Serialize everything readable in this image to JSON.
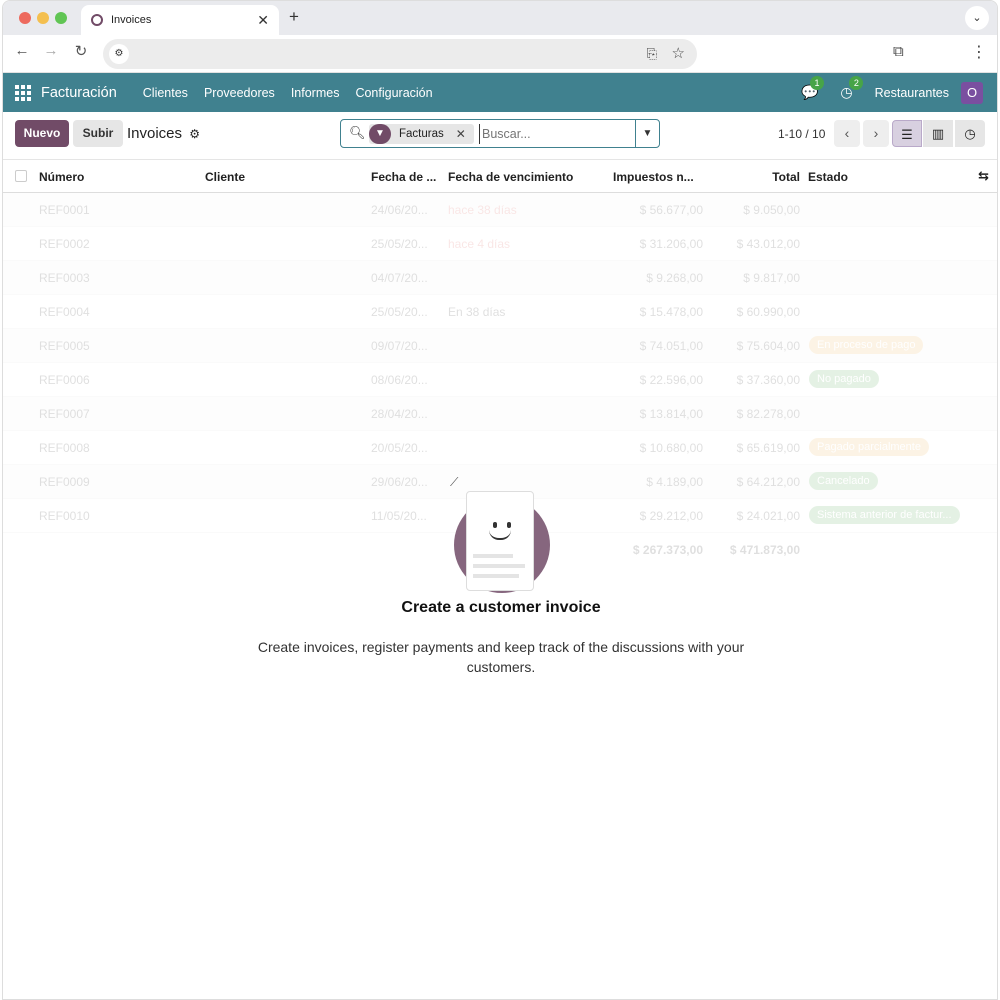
{
  "browser": {
    "tab_title": "Invoices",
    "new_tab": "+",
    "url": ""
  },
  "navbar": {
    "app_name": "Facturación",
    "menus": [
      "Clientes",
      "Proveedores",
      "Informes",
      "Configuración"
    ],
    "messages_count": "1",
    "activities_count": "2",
    "company": "Restaurantes",
    "avatar_letter": "O"
  },
  "control": {
    "new_label": "Nuevo",
    "upload_label": "Subir",
    "view_title": "Invoices",
    "facet_label": "Facturas",
    "search_placeholder": "Buscar...",
    "pager": "1-10 / 10"
  },
  "table": {
    "headers": {
      "numero": "Número",
      "cliente": "Cliente",
      "fecha": "Fecha de ...",
      "vencimiento": "Fecha de vencimiento",
      "impuestos": "Impuestos n...",
      "total": "Total",
      "estado": "Estado"
    },
    "rows": [
      {
        "num": "REF0001",
        "date": "24/06/20...",
        "due": "hace 38 días",
        "tax": "$ 56.677,00",
        "total": "$ 9.050,00",
        "state": ""
      },
      {
        "num": "REF0002",
        "date": "25/05/20...",
        "due": "hace 4 días",
        "tax": "$ 31.206,00",
        "total": "$ 43.012,00",
        "state": ""
      },
      {
        "num": "REF0003",
        "date": "04/07/20...",
        "due": "",
        "tax": "$ 9.268,00",
        "total": "$ 9.817,00",
        "state": ""
      },
      {
        "num": "REF0004",
        "date": "25/05/20...",
        "due": "En 38 días",
        "tax": "$ 15.478,00",
        "total": "$ 60.990,00",
        "state": ""
      },
      {
        "num": "REF0005",
        "date": "09/07/20...",
        "due": "",
        "tax": "$ 74.051,00",
        "total": "$ 75.604,00",
        "state": "En proceso de pago"
      },
      {
        "num": "REF0006",
        "date": "08/06/20...",
        "due": "",
        "tax": "$ 22.596,00",
        "total": "$ 37.360,00",
        "state": "No pagado"
      },
      {
        "num": "REF0007",
        "date": "28/04/20...",
        "due": "",
        "tax": "$ 13.814,00",
        "total": "$ 82.278,00",
        "state": ""
      },
      {
        "num": "REF0008",
        "date": "20/05/20...",
        "due": "",
        "tax": "$ 10.680,00",
        "total": "$ 65.619,00",
        "state": "Pagado parcialmente"
      },
      {
        "num": "REF0009",
        "date": "29/06/20...",
        "due": "",
        "tax": "$ 4.189,00",
        "total": "$ 64.212,00",
        "state": "Cancelado"
      },
      {
        "num": "REF0010",
        "date": "11/05/20...",
        "due": "",
        "tax": "$ 29.212,00",
        "total": "$ 24.021,00",
        "state": "Sistema anterior de factur..."
      }
    ],
    "totals": {
      "tax": "$ 267.373,00",
      "total": "$ 471.873,00"
    }
  },
  "helper": {
    "title": "Create a customer invoice",
    "text": "Create invoices, register payments and keep track of the discussions with your customers."
  },
  "colors": {
    "navbar": "#40818f",
    "primary": "#714b67",
    "badge": "#47a447"
  }
}
